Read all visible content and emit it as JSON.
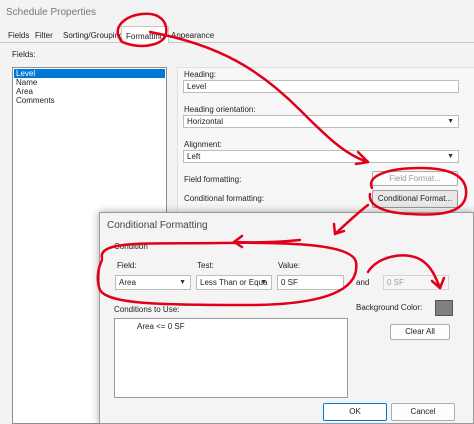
{
  "schedule_properties": {
    "title": "Schedule Properties",
    "tabs": [
      "Fields",
      "Filter",
      "Sorting/Grouping",
      "Formatting",
      "Appearance"
    ],
    "fields_label": "Fields:",
    "fields": [
      "Level",
      "Name",
      "Area",
      "Comments"
    ],
    "heading_label": "Heading:",
    "heading_value": "Level",
    "heading_orientation_label": "Heading orientation:",
    "heading_orientation_value": "Horizontal",
    "alignment_label": "Alignment:",
    "alignment_value": "Left",
    "field_formatting_label": "Field formatting:",
    "field_format_button": "Field Format...",
    "conditional_formatting_label": "Conditional formatting:",
    "conditional_format_button": "Conditional   Format..."
  },
  "conditional_formatting": {
    "title": "Conditional Formatting",
    "condition_label": "Condition",
    "field_label": "Field:",
    "field_value": "Area",
    "test_label": "Test:",
    "test_value": "Less Than or Equa",
    "value_label": "Value:",
    "value_value": "0 SF",
    "and_label": "and",
    "and_value": "0 SF",
    "background_color_label": "Background Color:",
    "background_color": "#7f7f7f",
    "conditions_to_use_label": "Conditions to Use:",
    "conditions": [
      "Area <= 0 SF"
    ],
    "clear_all_button": "Clear All",
    "ok_button": "OK",
    "cancel_button": "Cancel"
  },
  "annotation_color": "#e0001b"
}
